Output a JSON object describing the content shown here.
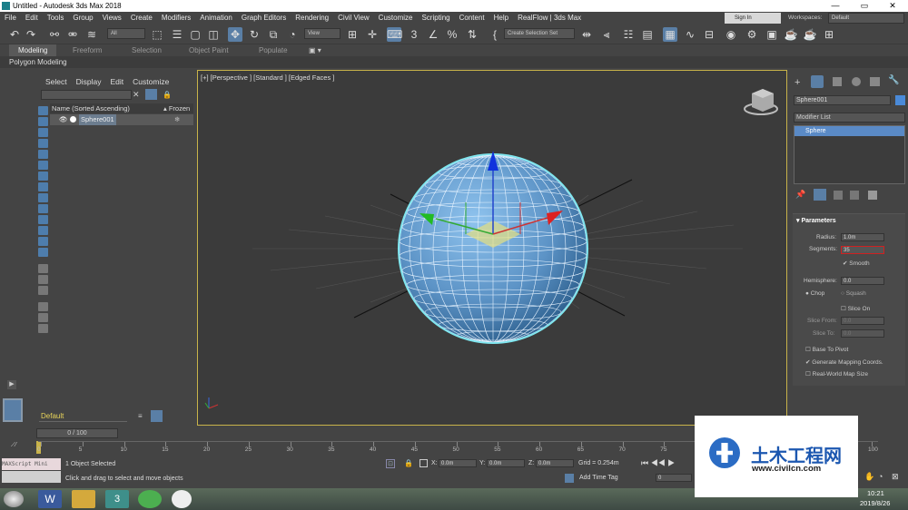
{
  "title": "Untitled - Autodesk 3ds Max 2018",
  "menu": [
    "File",
    "Edit",
    "Tools",
    "Group",
    "Views",
    "Create",
    "Modifiers",
    "Animation",
    "Graph Editors",
    "Rendering",
    "Civil View",
    "Customize",
    "Scripting",
    "Content",
    "Help",
    "RealFlow | 3ds Max"
  ],
  "sign_in": "Sign In",
  "workspaces_label": "Workspaces:",
  "workspaces_value": "Default",
  "toolbar": {
    "filter_value": "All",
    "view_value": "View",
    "create_selection_set": "Create Selection Set"
  },
  "ribbon": {
    "tabs": [
      "Modeling",
      "Freeform",
      "Selection",
      "Object Paint",
      "Populate"
    ],
    "sub": "Polygon Modeling"
  },
  "scene_explorer": {
    "menu": [
      "Select",
      "Display",
      "Edit",
      "Customize"
    ],
    "col_name": "Name (Sorted Ascending)",
    "col_frozen": "▴ Frozen",
    "object": "Sphere001",
    "layer": "Default"
  },
  "viewport": {
    "label": "[+] [Perspective ] [Standard ] [Edged Faces ]"
  },
  "command_panel": {
    "object_name": "Sphere001",
    "modifier_list": "Modifier List",
    "stack_item": "Sphere",
    "rollout": "Parameters",
    "radius_label": "Radius:",
    "radius_value": "1.0m",
    "segments_label": "Segments:",
    "segments_value": "35",
    "smooth": "Smooth",
    "hemisphere_label": "Hemisphere:",
    "hemisphere_value": "0.0",
    "chop": "Chop",
    "squash": "Squash",
    "slice_on": "Slice On",
    "slice_from_label": "Slice From:",
    "slice_from_value": "0.0",
    "slice_to_label": "Slice To:",
    "slice_to_value": "0.0",
    "base_to_pivot": "Base To Pivot",
    "gen_mapping": "Generate Mapping Coords.",
    "real_world": "Real-World Map Size"
  },
  "timeline": {
    "frame": "0 / 100",
    "ticks": [
      "0",
      "5",
      "10",
      "15",
      "20",
      "25",
      "30",
      "35",
      "40",
      "45",
      "50",
      "55",
      "60",
      "65",
      "70",
      "75",
      "80",
      "85",
      "90",
      "95",
      "100"
    ]
  },
  "status": {
    "maxscript": "MAXScript Mini",
    "selected": "1 Object Selected",
    "hint": "Click and drag to select and move objects",
    "x_label": "X:",
    "x_value": "0.0m",
    "y_label": "Y:",
    "y_value": "0.0m",
    "z_label": "Z:",
    "z_value": "0.0m",
    "grid": "Grid = 0.254m",
    "add_time_tag": "Add Time Tag",
    "frame_spinner": "0"
  },
  "taskbar": {
    "time": "10:21",
    "date": "2019/8/26"
  },
  "watermark": {
    "cn": "土木工程网",
    "url": "www.civilcn.com"
  }
}
